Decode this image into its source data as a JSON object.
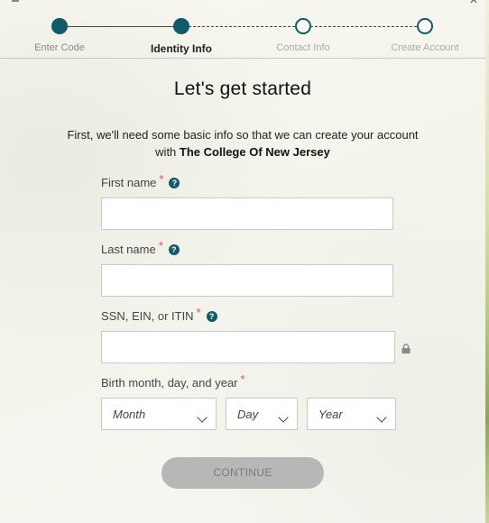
{
  "window": {
    "close_glyph": "×"
  },
  "stepper": {
    "steps": [
      {
        "label": "Enter Code",
        "state": "complete"
      },
      {
        "label": "Identity Info",
        "state": "active"
      },
      {
        "label": "Contact Info",
        "state": "future"
      },
      {
        "label": "Create Account",
        "state": "future"
      }
    ]
  },
  "header": {
    "title": "Let's get started",
    "subtitle_line1": "First, we'll need some basic info so that we can create your account",
    "subtitle_with": "with",
    "institution": "The College Of New Jersey"
  },
  "form": {
    "first_name": {
      "label": "First name",
      "required": "*",
      "help": "?",
      "value": ""
    },
    "last_name": {
      "label": "Last name",
      "required": "*",
      "help": "?",
      "value": ""
    },
    "ssn": {
      "label": "SSN, EIN, or ITIN",
      "required": "*",
      "help": "?",
      "value": ""
    },
    "birth": {
      "label": "Birth month, day, and year",
      "required": "*",
      "month_placeholder": "Month",
      "day_placeholder": "Day",
      "year_placeholder": "Year"
    },
    "continue_label": "CONTINUE"
  },
  "colors": {
    "accent": "#0f5a6b",
    "required": "#e84a5f",
    "button_disabled": "#b7b7b7"
  }
}
